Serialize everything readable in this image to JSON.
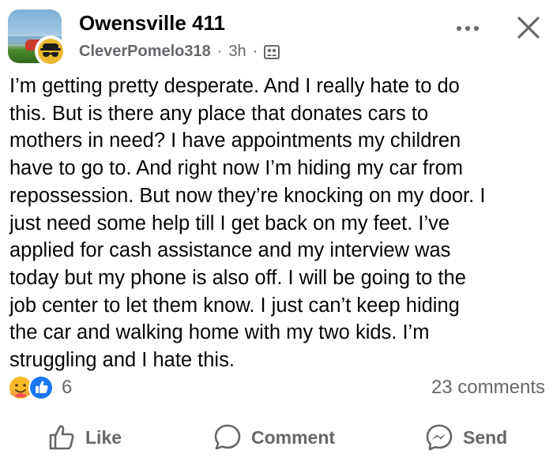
{
  "post": {
    "group_name": "Owensville 411",
    "author": "CleverPomelo318",
    "separator": "·",
    "time": "3h",
    "audience_icon": "group-audience-icon",
    "body": "I’m getting pretty desperate. And I really hate to do\nthis. But is there any place that donates cars to\nmothers in need? I have appointments my children\nhave to go to. And right now I’m hiding my car from\nrepossession. But now they’re knocking on my door. I\njust need some help till I get back on my feet. I’ve\napplied for cash assistance and my interview was\ntoday but my phone is also off. I will be going to the\njob center to let them know. I just can’t keep hiding\nthe car and walking home with my two kids. I’m\nstruggling and I hate this."
  },
  "reactions": {
    "icons": [
      "care-reaction-icon",
      "like-reaction-icon"
    ],
    "count": "6",
    "comments": "23 comments"
  },
  "actions": {
    "like": "Like",
    "comment": "Comment",
    "send": "Send"
  },
  "colors": {
    "text": "#050505",
    "secondary": "#65676b",
    "like_blue": "#1877f2",
    "care_yellow": "#f7b928"
  }
}
